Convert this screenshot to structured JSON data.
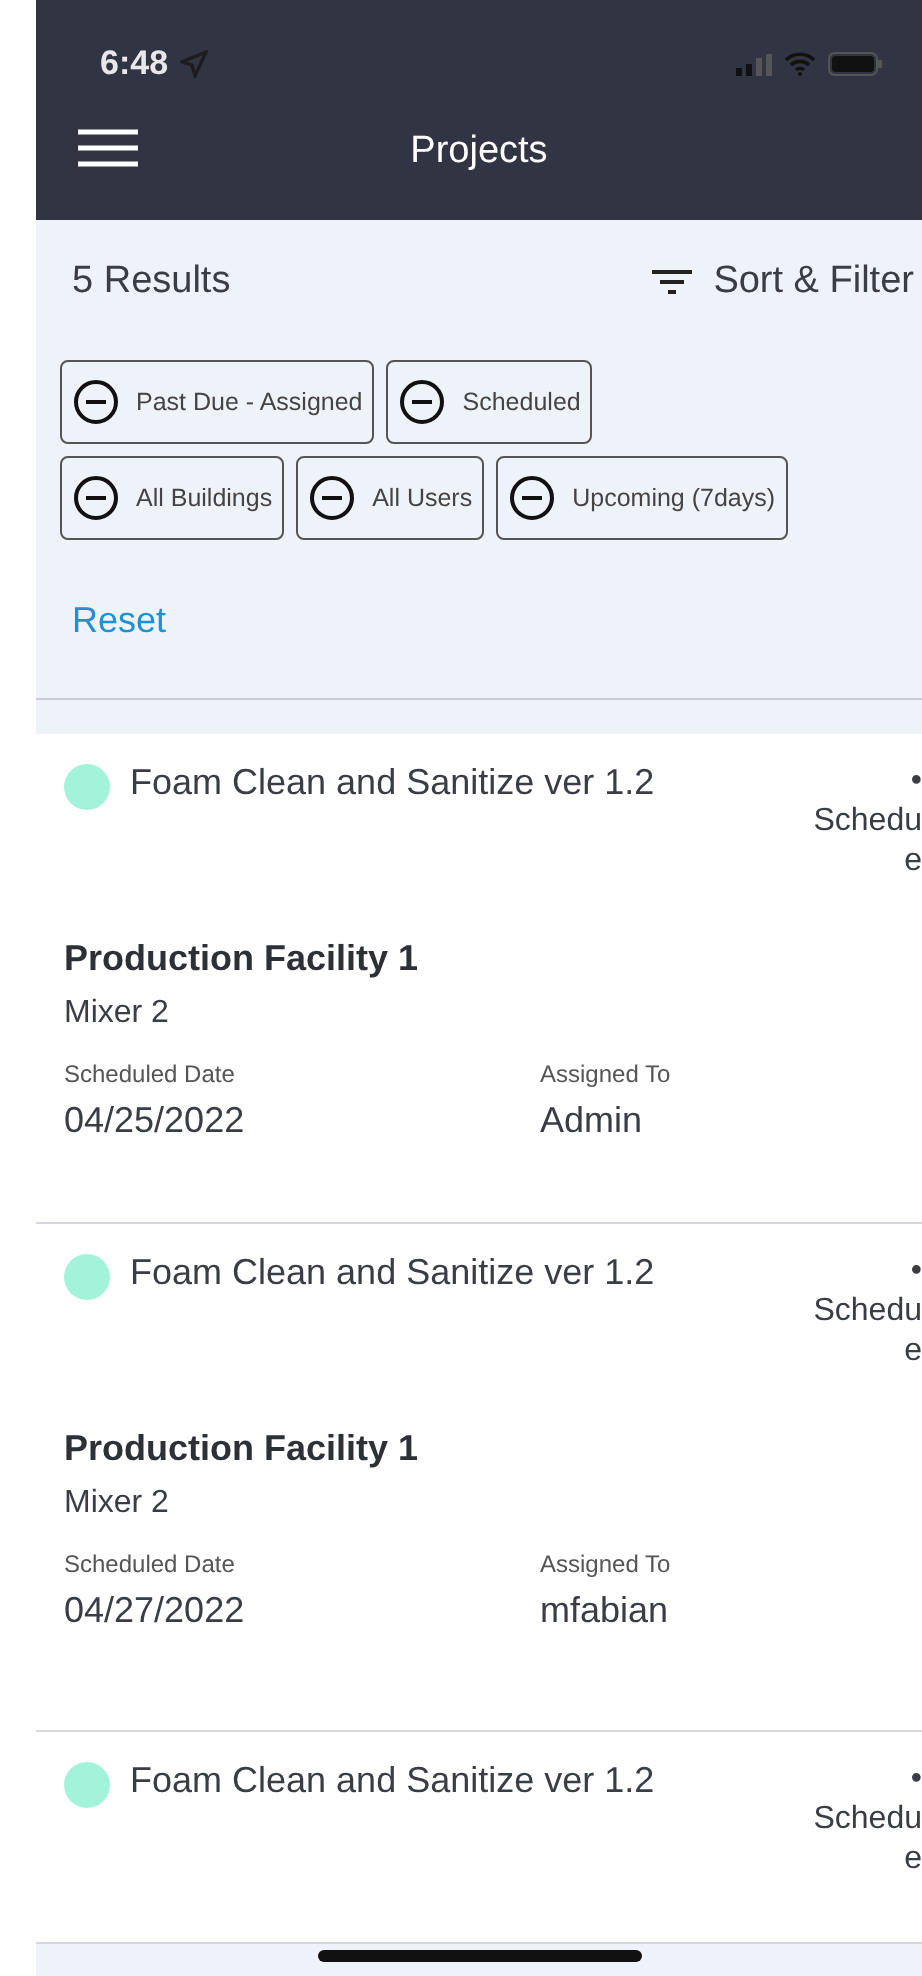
{
  "status_bar": {
    "time": "6:48"
  },
  "header": {
    "title": "Projects"
  },
  "results": {
    "count": "5 Results",
    "sort_label": "Sort & Filter"
  },
  "filters": [
    {
      "label": "Past Due - Assigned"
    },
    {
      "label": "Scheduled"
    },
    {
      "label": "All Buildings"
    },
    {
      "label": "All Users"
    },
    {
      "label": "Upcoming (7days)"
    }
  ],
  "reset": "Reset",
  "projects": [
    {
      "title": "Foam Clean and Sanitize ver 1.2",
      "color": "#a3f2da",
      "status": [
        "•",
        "Schedu",
        "e"
      ],
      "facility": "Production Facility 1",
      "equipment": "Mixer 2",
      "date_label": "Scheduled Date",
      "date": "04/25/2022",
      "assigned_label": "Assigned To",
      "assigned": "Admin"
    },
    {
      "title": "Foam Clean and Sanitize ver 1.2",
      "color": "#a3f2da",
      "status": [
        "•",
        "Schedu",
        "e"
      ],
      "facility": "Production Facility 1",
      "equipment": "Mixer 2",
      "date_label": "Scheduled Date",
      "date": "04/27/2022",
      "assigned_label": "Assigned To",
      "assigned": "mfabian"
    },
    {
      "title": "Foam Clean and Sanitize ver 1.2",
      "color": "#a3f2da",
      "status": [
        "•",
        "Schedu",
        "e"
      ]
    }
  ]
}
